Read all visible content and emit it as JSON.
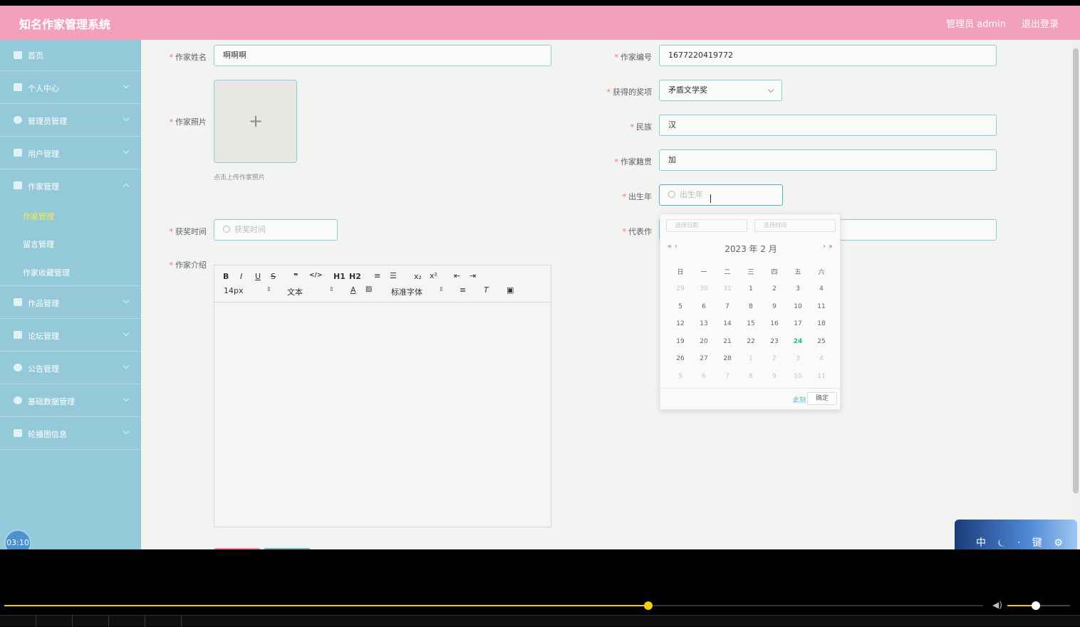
{
  "app": {
    "title": "知名作家管理系统",
    "user_label": "管理员 admin",
    "logout_label": "退出登录",
    "accent": "#f2a0bb",
    "sidebar_color": "#94c9d9"
  },
  "sidebar": {
    "items": [
      {
        "label": "首页",
        "icon": "home-icon"
      },
      {
        "label": "个人中心",
        "icon": "user-icon"
      },
      {
        "label": "管理员管理",
        "icon": "admin-icon"
      },
      {
        "label": "用户管理",
        "icon": "users-icon"
      },
      {
        "label": "作家管理",
        "icon": "briefcase-icon"
      },
      {
        "label": "作品管理",
        "icon": "grid-icon"
      },
      {
        "label": "论坛管理",
        "icon": "list-icon"
      },
      {
        "label": "公告管理",
        "icon": "power-icon"
      },
      {
        "label": "基础数据管理",
        "icon": "globe-icon"
      },
      {
        "label": "轮播图信息",
        "icon": "chat-icon"
      }
    ],
    "sub_items": [
      {
        "label": "作家管理",
        "active": true
      },
      {
        "label": "留言管理",
        "active": false
      },
      {
        "label": "作家收藏管理",
        "active": false
      }
    ]
  },
  "form": {
    "name": {
      "label": "作家姓名",
      "value": "啊啊啊"
    },
    "number": {
      "label": "作家编号",
      "value": "1677220419772"
    },
    "photo": {
      "label": "作家照片",
      "hint": "点击上传作家照片"
    },
    "award": {
      "label": "获得的奖项",
      "value": "矛盾文学奖"
    },
    "ethnicity": {
      "label": "民族",
      "value": "汉"
    },
    "hometown": {
      "label": "作家籍贯",
      "value": "加"
    },
    "birth_year": {
      "label": "出生年",
      "placeholder": "出生年"
    },
    "award_time": {
      "label": "获奖时间",
      "placeholder": "获奖时间"
    },
    "masterpiece": {
      "label": "代表作",
      "placeholder": "代表作"
    },
    "intro": {
      "label": "作家介绍"
    }
  },
  "editor": {
    "toolbar_row1": [
      "B",
      "I",
      "U",
      "S",
      "❞",
      "</>",
      "H1",
      "H2",
      "≡",
      "☰",
      "x₂",
      "x²",
      "⇤",
      "⇥"
    ],
    "font_size": "14px",
    "text_style": "文本",
    "font_family": "标准字体"
  },
  "date_picker": {
    "date_placeholder": "选择日期",
    "time_placeholder": "选择时间",
    "header": "2023 年  2 月",
    "weekdays": [
      "日",
      "一",
      "二",
      "三",
      "四",
      "五",
      "六"
    ],
    "weeks": [
      [
        "29",
        "30",
        "31",
        "1",
        "2",
        "3",
        "4"
      ],
      [
        "5",
        "6",
        "7",
        "8",
        "9",
        "10",
        "11"
      ],
      [
        "12",
        "13",
        "14",
        "15",
        "16",
        "17",
        "18"
      ],
      [
        "19",
        "20",
        "21",
        "22",
        "23",
        "24",
        "25"
      ],
      [
        "26",
        "27",
        "28",
        "1",
        "2",
        "3",
        "4"
      ],
      [
        "5",
        "6",
        "7",
        "8",
        "9",
        "10",
        "11"
      ]
    ],
    "today": "24",
    "now_label": "此刻",
    "ok_label": "确定"
  },
  "overlay": {
    "timer": "03:10",
    "ime_text": "中 ⏾ · 键 ⚙"
  },
  "player": {
    "progress": 0.658,
    "volume": 0.45
  }
}
